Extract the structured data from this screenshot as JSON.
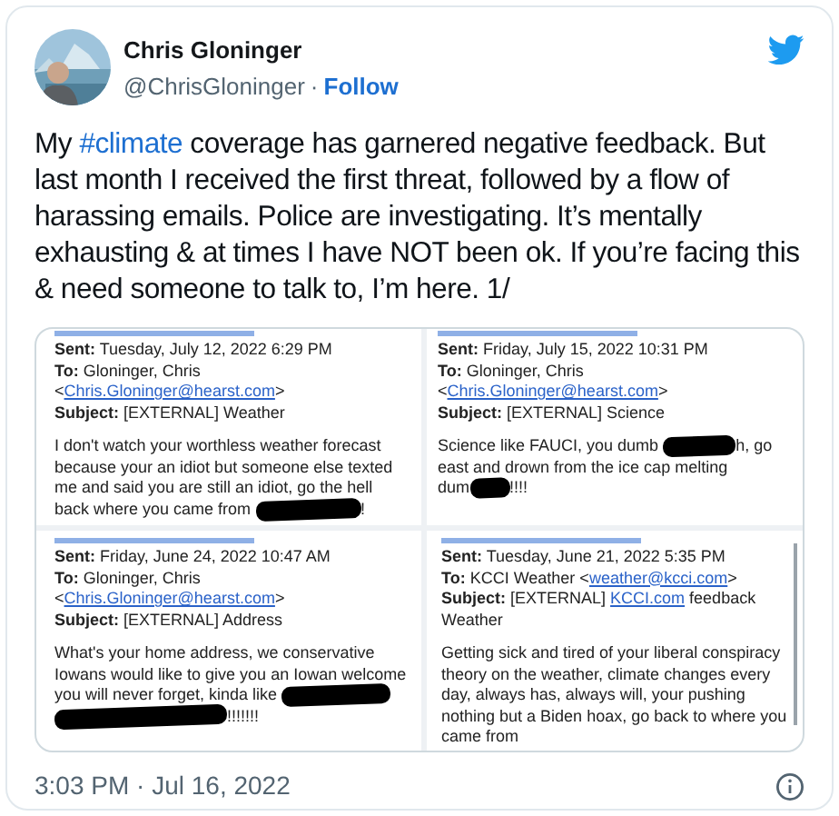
{
  "author": {
    "name": "Chris Gloninger",
    "handle": "@ChrisGloninger",
    "separator": "·",
    "follow": "Follow"
  },
  "tweet": {
    "before": "My ",
    "hashtag": "#climate",
    "after": " coverage has garnered negative feedback. But last month I received the first threat, followed by a flow of harassing emails. Police are investigating. It’s mentally exhausting & at times I have NOT been ok. If you’re facing this & need someone to talk to, I’m here. 1/"
  },
  "emails": [
    {
      "header": [
        [
          {
            "kind": "label",
            "text": "Sent:"
          },
          {
            "kind": "text",
            "text": " Tuesday, July 12, 2022 6:29 PM"
          }
        ],
        [
          {
            "kind": "label",
            "text": "To:"
          },
          {
            "kind": "text",
            "text": " Gloninger, Chris"
          }
        ],
        [
          {
            "kind": "text",
            "text": "<"
          },
          {
            "kind": "link",
            "text": "Chris.Gloninger@hearst.com"
          },
          {
            "kind": "text",
            "text": ">"
          }
        ],
        [
          {
            "kind": "label",
            "text": "Subject:"
          },
          {
            "kind": "text",
            "text": " [EXTERNAL] Weather"
          }
        ]
      ],
      "body": [
        [
          {
            "kind": "text",
            "text": "I don't watch your worthless weather forecast"
          }
        ],
        [
          {
            "kind": "text",
            "text": "because your an idiot but someone else texted"
          }
        ],
        [
          {
            "kind": "text",
            "text": "me and said you are still an idiot, go the hell"
          }
        ],
        [
          {
            "kind": "text",
            "text": "back where you came from "
          },
          {
            "kind": "redaction"
          },
          {
            "kind": "text",
            "text": "!"
          }
        ]
      ]
    },
    {
      "header": [
        [
          {
            "kind": "label",
            "text": "Sent:"
          },
          {
            "kind": "text",
            "text": " Friday, July 15, 2022 10:31 PM"
          }
        ],
        [
          {
            "kind": "label",
            "text": "To:"
          },
          {
            "kind": "text",
            "text": " Gloninger, Chris"
          }
        ],
        [
          {
            "kind": "text",
            "text": "<"
          },
          {
            "kind": "link",
            "text": "Chris.Gloninger@hearst.com"
          },
          {
            "kind": "text",
            "text": ">"
          }
        ],
        [
          {
            "kind": "label",
            "text": "Subject:"
          },
          {
            "kind": "text",
            "text": " [EXTERNAL] Science"
          }
        ]
      ],
      "body": [
        [
          {
            "kind": "text",
            "text": "Science like FAUCI, you dumb "
          },
          {
            "kind": "redaction"
          },
          {
            "kind": "text",
            "text": "h, go"
          }
        ],
        [
          {
            "kind": "text",
            "text": "east and drown from the ice cap melting"
          }
        ],
        [
          {
            "kind": "text",
            "text": "dum"
          },
          {
            "kind": "redaction"
          },
          {
            "kind": "text",
            "text": "!!!!"
          }
        ]
      ]
    },
    {
      "header": [
        [
          {
            "kind": "label",
            "text": "Sent:"
          },
          {
            "kind": "text",
            "text": " Friday, June 24, 2022 10:47 AM"
          }
        ],
        [
          {
            "kind": "label",
            "text": "To:"
          },
          {
            "kind": "text",
            "text": " Gloninger, Chris"
          }
        ],
        [
          {
            "kind": "text",
            "text": "<"
          },
          {
            "kind": "link",
            "text": "Chris.Gloninger@hearst.com"
          },
          {
            "kind": "text",
            "text": ">"
          }
        ],
        [
          {
            "kind": "label",
            "text": "Subject:"
          },
          {
            "kind": "text",
            "text": " [EXTERNAL] Address"
          }
        ]
      ],
      "body": [
        [
          {
            "kind": "text",
            "text": "What's your home address, we conservative"
          }
        ],
        [
          {
            "kind": "text",
            "text": "Iowans would like to give you an Iowan welcome"
          }
        ],
        [
          {
            "kind": "text",
            "text": "you will never forget, kinda like "
          },
          {
            "kind": "redaction"
          }
        ],
        [
          {
            "kind": "redaction"
          },
          {
            "kind": "text",
            "text": "!!!!!!!"
          }
        ]
      ]
    },
    {
      "header": [
        [
          {
            "kind": "label",
            "text": "Sent:"
          },
          {
            "kind": "text",
            "text": " Tuesday, June 21, 2022 5:35 PM"
          }
        ],
        [
          {
            "kind": "label",
            "text": "To:"
          },
          {
            "kind": "text",
            "text": " KCCI Weather <"
          },
          {
            "kind": "link",
            "text": "weather@kcci.com"
          },
          {
            "kind": "text",
            "text": ">"
          }
        ],
        [
          {
            "kind": "label",
            "text": "Subject:"
          },
          {
            "kind": "text",
            "text": " [EXTERNAL] "
          },
          {
            "kind": "link",
            "text": "KCCI.com"
          },
          {
            "kind": "text",
            "text": " feedback"
          }
        ],
        [
          {
            "kind": "text",
            "text": "Weather"
          }
        ]
      ],
      "body": [
        [
          {
            "kind": "text",
            "text": "Getting sick and tired of your liberal conspiracy"
          }
        ],
        [
          {
            "kind": "text",
            "text": "theory on the weather, climate changes every"
          }
        ],
        [
          {
            "kind": "text",
            "text": "day, always has, always will, your pushing"
          }
        ],
        [
          {
            "kind": "text",
            "text": "nothing but a Biden hoax, go back to where you"
          }
        ],
        [
          {
            "kind": "text",
            "text": "came from"
          }
        ]
      ]
    }
  ],
  "timestamp": "3:03 PM · Jul 16, 2022"
}
